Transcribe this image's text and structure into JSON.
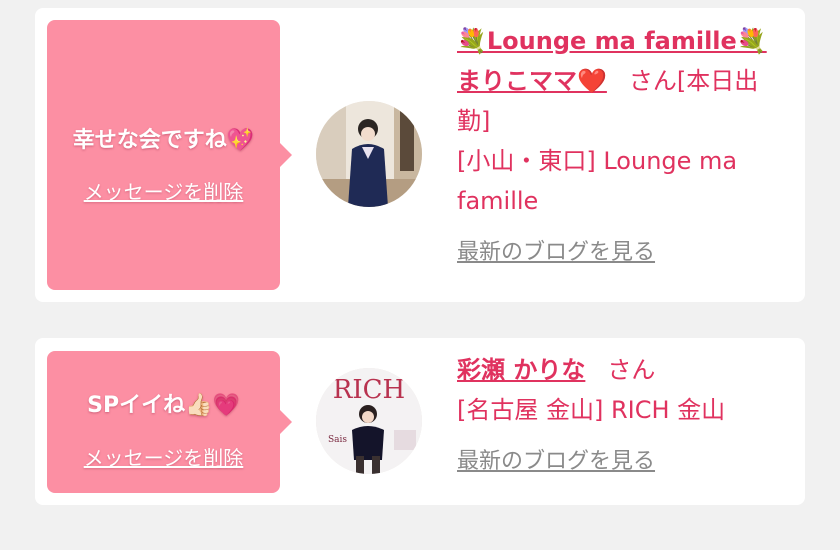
{
  "cards": [
    {
      "bubble": {
        "message": "幸せな会ですね💖",
        "delete_label": "メッセージを削除"
      },
      "cast": {
        "name_line1": "💐Lounge ma famille💐",
        "name_line2": "まりこママ❤️",
        "suffix": "さん[本日出勤]",
        "location": "[小山・東口] Lounge ma famille",
        "blog_link": "最新のブログを見る"
      }
    },
    {
      "bubble": {
        "message": "SPイイね👍🏻💗",
        "delete_label": "メッセージを削除"
      },
      "cast": {
        "name": "彩瀬 かりな",
        "suffix": "さん",
        "location": "[名古屋 金山] RICH 金山",
        "blog_link": "最新のブログを見る"
      }
    }
  ],
  "colors": {
    "background": "#f1f1f1",
    "card": "#ffffff",
    "bubble": "#fc8fa3",
    "accent": "#e0325f",
    "muted_link": "#8a8a8a"
  }
}
